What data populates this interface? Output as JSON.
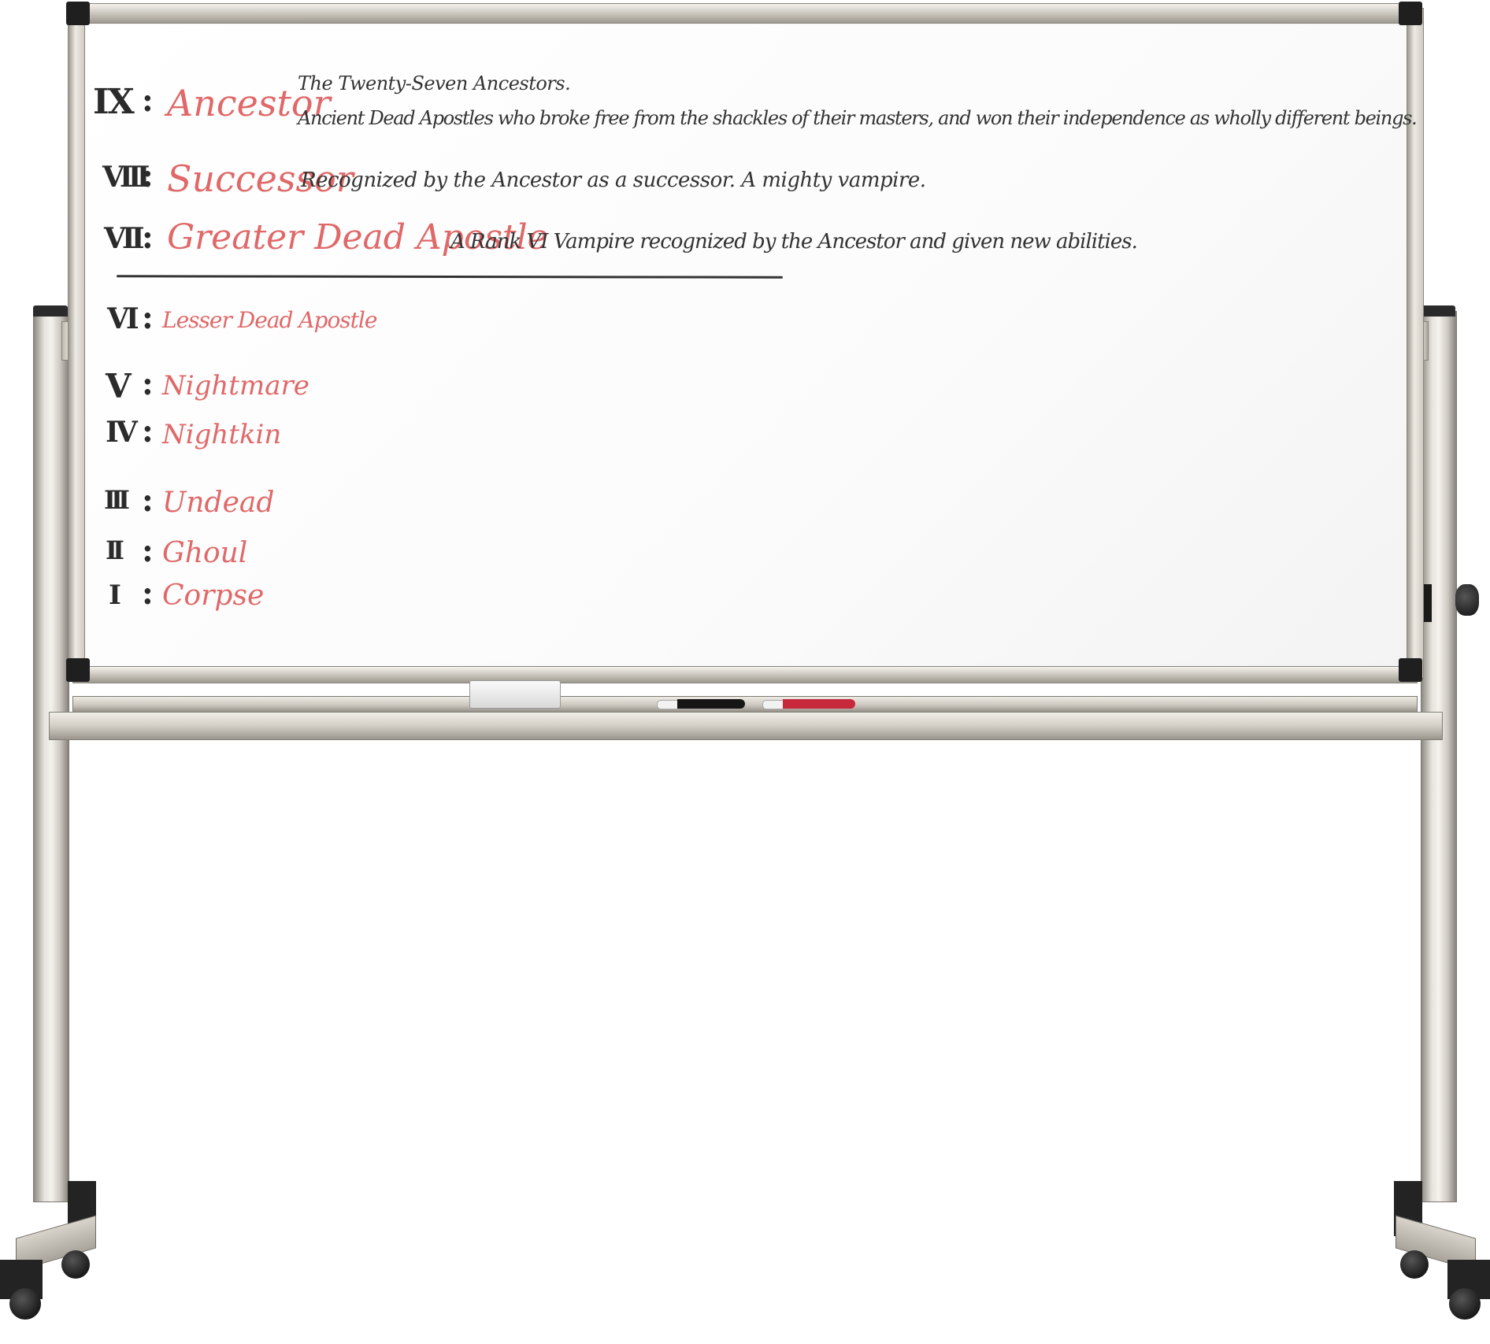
{
  "board": {
    "ranks": [
      {
        "numeral": "IX",
        "name": "Ancestor",
        "desc1": "The Twenty-Seven Ancestors.",
        "desc2": "Ancient Dead Apostles who broke free from the shackles of their masters, and won their independence as wholly different beings."
      },
      {
        "numeral": "VIII",
        "name": "Successor",
        "desc1": "Recognized by the Ancestor as a successor. A mighty vampire."
      },
      {
        "numeral": "VII",
        "name": "Greater Dead Apostle",
        "desc1": "A Rank VI Vampire recognized by the Ancestor and given new abilities."
      },
      {
        "numeral": "VI",
        "name": "Lesser Dead Apostle"
      },
      {
        "numeral": "V",
        "name": "Nightmare"
      },
      {
        "numeral": "IV",
        "name": "Nightkin"
      },
      {
        "numeral": "III",
        "name": "Undead"
      },
      {
        "numeral": "II",
        "name": "Ghoul"
      },
      {
        "numeral": "I",
        "name": "Corpse"
      }
    ],
    "separator": ":"
  },
  "colors": {
    "marker_red": "#e06868",
    "marker_black": "#333333",
    "frame_corner": "#1f1f1f",
    "frame_aluminum": "#cfcbc3"
  },
  "icons": {
    "eraser": "eraser-icon",
    "black_marker": "black-marker-icon",
    "red_marker": "red-marker-icon",
    "knob": "tilt-knob-icon",
    "wheel": "caster-wheel-icon"
  }
}
